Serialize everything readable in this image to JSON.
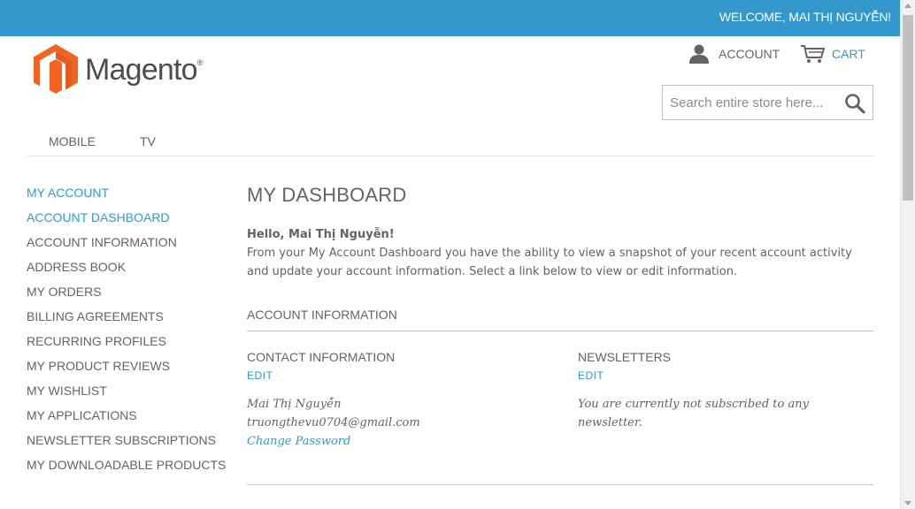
{
  "header": {
    "welcome": "WELCOME, MAI THỊ NGUYỄN!",
    "logo_text": "Magento",
    "logo_reg": "®",
    "account_label": "ACCOUNT",
    "account_icon": "user-icon",
    "cart_label": "CART",
    "cart_icon": "cart-icon",
    "search_placeholder": "Search entire store here...",
    "search_icon": "search-icon"
  },
  "nav": {
    "items": [
      "MOBILE",
      "TV"
    ]
  },
  "sidebar": {
    "title": "MY ACCOUNT",
    "items": [
      "ACCOUNT DASHBOARD",
      "ACCOUNT INFORMATION",
      "ADDRESS BOOK",
      "MY ORDERS",
      "BILLING AGREEMENTS",
      "RECURRING PROFILES",
      "MY PRODUCT REVIEWS",
      "MY WISHLIST",
      "MY APPLICATIONS",
      "NEWSLETTER SUBSCRIPTIONS",
      "MY DOWNLOADABLE PRODUCTS"
    ],
    "current_index": 0
  },
  "main": {
    "title": "MY DASHBOARD",
    "hello": "Hello, Mai Thị Nguyễn!",
    "intro": "From your My Account Dashboard you have the ability to view a snapshot of your recent account activity and update your account information. Select a link below to view or edit information.",
    "section_title": "ACCOUNT INFORMATION",
    "contact": {
      "title": "CONTACT INFORMATION",
      "edit": "EDIT",
      "name": "Mai Thị Nguyễn",
      "email": "truongthevu0704@gmail.com",
      "change_password": "Change Password"
    },
    "newsletters": {
      "title": "NEWSLETTERS",
      "edit": "EDIT",
      "text": "You are currently not subscribed to any newsletter."
    }
  },
  "colors": {
    "accent": "#3399cc",
    "text": "#636363",
    "logo_orange": "#f26322"
  }
}
